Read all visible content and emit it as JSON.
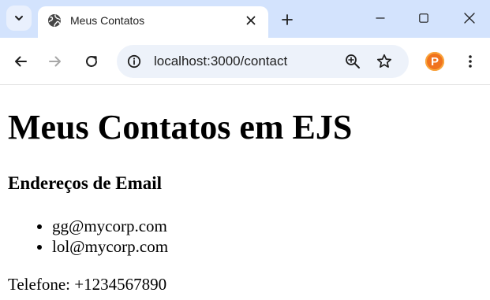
{
  "browser": {
    "tab": {
      "title": "Meus Contatos"
    },
    "address_bar": {
      "url": "localhost:3000/contact"
    },
    "profile": {
      "initial": "P",
      "color": "#f0731e"
    },
    "icons": {
      "tab_search": "chevron-down-icon",
      "favicon": "globe-icon",
      "tab_close": "close-icon",
      "new_tab": "plus-icon",
      "minimize": "minimize-icon",
      "maximize": "maximize-icon",
      "window_close": "close-icon",
      "back": "arrow-left-icon",
      "forward": "arrow-right-icon",
      "reload": "reload-icon",
      "site_info": "info-icon",
      "zoom": "zoom-in-icon",
      "bookmark": "star-icon",
      "menu": "kebab-menu-icon"
    },
    "colors": {
      "tabstrip": "#d3e3fd",
      "omnibox": "#edf2fa"
    }
  },
  "page": {
    "heading": "Meus Contatos em EJS",
    "subheading": "Endereços de Email",
    "emails": [
      "gg@mycorp.com",
      "lol@mycorp.com"
    ],
    "phone_line": "Telefone: +1234567890"
  }
}
